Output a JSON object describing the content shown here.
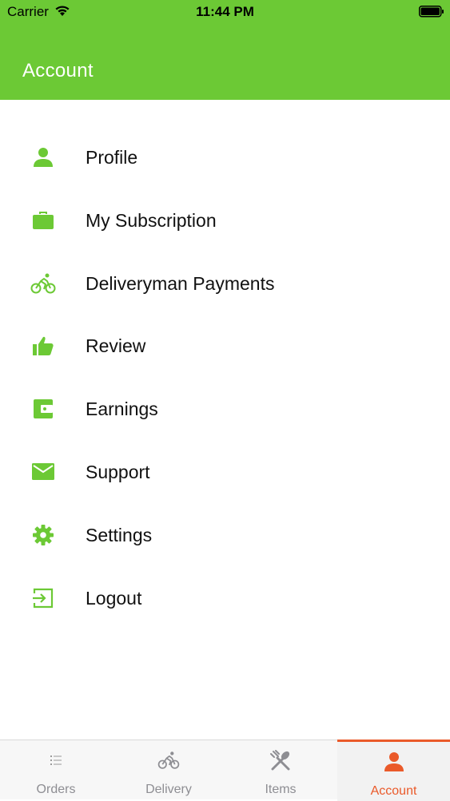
{
  "status_bar": {
    "carrier": "Carrier",
    "time": "11:44 PM"
  },
  "header": {
    "title": "Account",
    "background": "#6cc935"
  },
  "menu": {
    "items": [
      {
        "label": "Profile",
        "icon": "person-icon"
      },
      {
        "label": "My Subscription",
        "icon": "briefcase-icon"
      },
      {
        "label": "Deliveryman Payments",
        "icon": "bicycle-icon"
      },
      {
        "label": "Review",
        "icon": "thumbs-up-icon"
      },
      {
        "label": "Earnings",
        "icon": "wallet-icon"
      },
      {
        "label": "Support",
        "icon": "envelope-icon"
      },
      {
        "label": "Settings",
        "icon": "gear-icon"
      },
      {
        "label": "Logout",
        "icon": "logout-icon"
      }
    ],
    "icon_color": "#6cc935"
  },
  "tabbar": {
    "tabs": [
      {
        "label": "Orders",
        "icon": "list-icon",
        "active": false
      },
      {
        "label": "Delivery",
        "icon": "bicycle-icon",
        "active": false
      },
      {
        "label": "Items",
        "icon": "utensils-icon",
        "active": false
      },
      {
        "label": "Account",
        "icon": "person-icon",
        "active": true
      }
    ],
    "active_color": "#ea5a2a",
    "inactive_color": "#8e8e93"
  }
}
